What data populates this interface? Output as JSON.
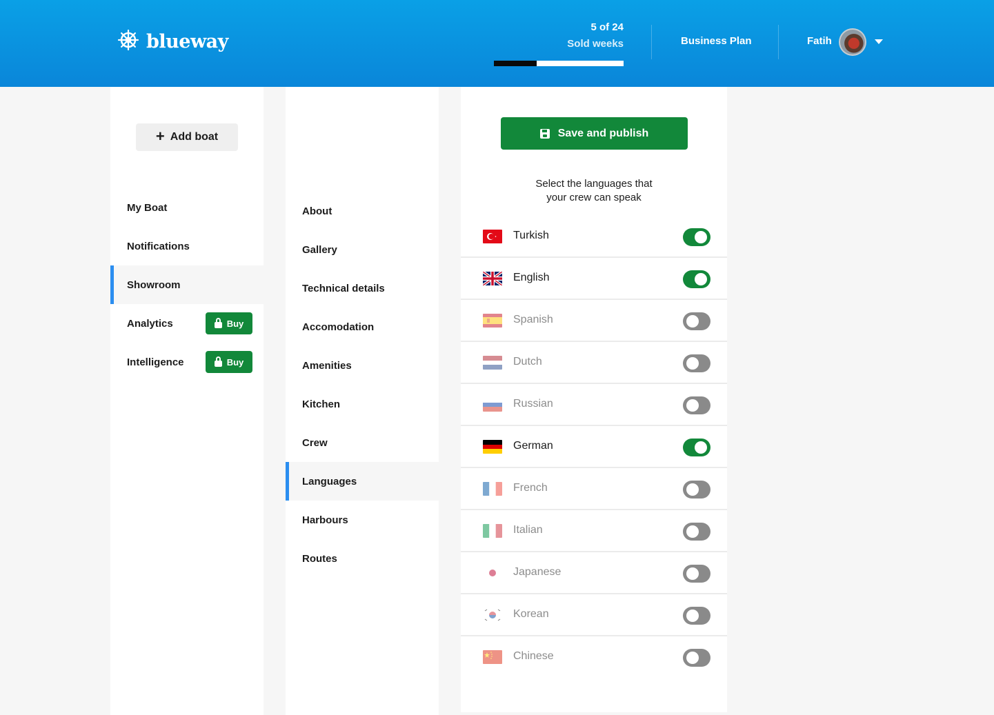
{
  "header": {
    "logo_text": "blueway",
    "sold_count": "5 of 24",
    "sold_label": "Sold weeks",
    "sold_progress": 0.33,
    "business_plan": "Business Plan",
    "user_name": "Fatih"
  },
  "sidebar": {
    "add_boat": "Add boat",
    "items": [
      {
        "label": "My Boat"
      },
      {
        "label": "Notifications"
      },
      {
        "label": "Showroom",
        "active": true
      },
      {
        "label": "Analytics",
        "badge": "Buy"
      },
      {
        "label": "Intelligence",
        "badge": "Buy"
      }
    ]
  },
  "subnav": {
    "items": [
      {
        "label": "About"
      },
      {
        "label": "Gallery"
      },
      {
        "label": "Technical details"
      },
      {
        "label": "Accomodation"
      },
      {
        "label": "Amenities"
      },
      {
        "label": "Kitchen"
      },
      {
        "label": "Crew"
      },
      {
        "label": "Languages",
        "active": true
      },
      {
        "label": "Harbours"
      },
      {
        "label": "Routes"
      }
    ]
  },
  "languages_panel": {
    "save_label": "Save and publish",
    "instruction_line1": "Select the languages that",
    "instruction_line2": "your crew can speak",
    "languages": [
      {
        "name": "Turkish",
        "flag": "turkey-flag-icon",
        "enabled": true
      },
      {
        "name": "English",
        "flag": "uk-flag-icon",
        "enabled": true
      },
      {
        "name": "Spanish",
        "flag": "spain-flag-icon",
        "enabled": false
      },
      {
        "name": "Dutch",
        "flag": "netherlands-flag-icon",
        "enabled": false
      },
      {
        "name": "Russian",
        "flag": "russia-flag-icon",
        "enabled": false
      },
      {
        "name": "German",
        "flag": "germany-flag-icon",
        "enabled": true
      },
      {
        "name": "French",
        "flag": "france-flag-icon",
        "enabled": false
      },
      {
        "name": "Italian",
        "flag": "italy-flag-icon",
        "enabled": false
      },
      {
        "name": "Japanese",
        "flag": "japan-flag-icon",
        "enabled": false
      },
      {
        "name": "Korean",
        "flag": "korea-flag-icon",
        "enabled": false
      },
      {
        "name": "Chinese",
        "flag": "china-flag-icon",
        "enabled": false
      }
    ]
  },
  "colors": {
    "header_blue": "#0a96e0",
    "accent_green": "#12883a",
    "active_indicator": "#2b8ef0"
  }
}
